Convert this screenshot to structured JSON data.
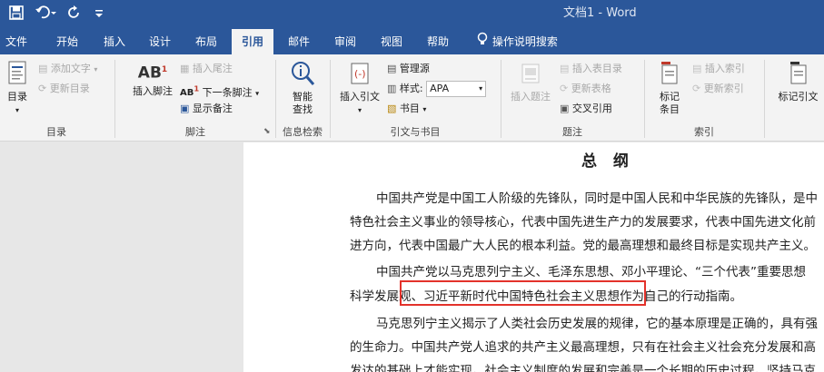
{
  "title_bar": {
    "doc_title": "文档1  -  Word"
  },
  "tabs": [
    {
      "label": "文件"
    },
    {
      "label": "开始"
    },
    {
      "label": "插入"
    },
    {
      "label": "设计"
    },
    {
      "label": "布局"
    },
    {
      "label": "引用"
    },
    {
      "label": "邮件"
    },
    {
      "label": "审阅"
    },
    {
      "label": "视图"
    },
    {
      "label": "帮助"
    }
  ],
  "tell_me": "操作说明搜索",
  "active_tab": "引用",
  "ribbon": {
    "toc": {
      "big_label": "目录",
      "add_text": "添加文字",
      "update_toc": "更新目录",
      "group": "目录"
    },
    "footnotes": {
      "insert_footnote": "插入脚注",
      "insert_endnote": "插入尾注",
      "next_footnote": "下一条脚注",
      "show_notes": "显示备注",
      "group": "脚注"
    },
    "research": {
      "smart_lookup": "智能",
      "smart_lookup2": "查找",
      "group": "信息检索"
    },
    "citations": {
      "insert_citation": "插入引文",
      "manage_sources": "管理源",
      "style_label": "样式:",
      "style_value": "APA",
      "bibliography": "书目",
      "group": "引文与书目"
    },
    "captions": {
      "insert_caption": "插入题注",
      "insert_table_of_figures": "插入表目录",
      "update_table": "更新表格",
      "cross_reference": "交叉引用",
      "group": "题注"
    },
    "index": {
      "mark_entry": "标记",
      "mark_entry2": "条目",
      "insert_index": "插入索引",
      "update_index": "更新索引",
      "group": "索引"
    },
    "toa": {
      "mark_citation": "标记引文"
    }
  },
  "document": {
    "heading": "总  纲",
    "lines": [
      "中国共产党是中国工人阶级的先锋队，同时是中国人民和中华民族的先锋队，是中",
      "特色社会主义事业的领导核心，代表中国先进生产力的发展要求，代表中国先进文化前",
      "进方向，代表中国最广大人民的根本利益。党的最高理想和最终目标是实现共产主义。",
      "中国共产党以马克思列宁主义、毛泽东思想、邓小平理论、“三个代表”重要思想",
      "科学发展观、习近平新时代中国特色社会主义思想作为自己的行动指南。",
      "马克思列宁主义揭示了人类社会历史发展的规律，它的基本原理是正确的，具有强",
      "的生命力。中国共产党人追求的共产主义最高理想，只有在社会主义社会充分发展和高",
      "发达的基础上才能实现。社会主义制度的发展和完善是一个长期的历史过程。坚持马克"
    ]
  },
  "colors": {
    "brand": "#2b579a",
    "highlight_box": "#e3322b"
  }
}
